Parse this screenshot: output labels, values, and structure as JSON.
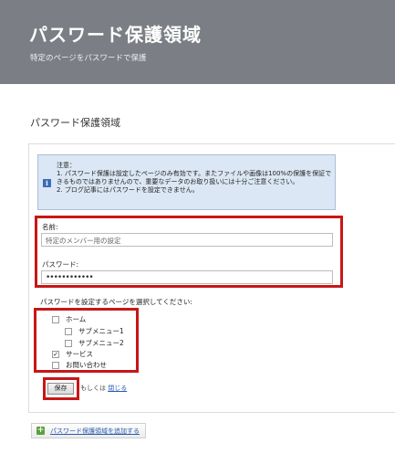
{
  "header": {
    "title": "パスワード保護領域",
    "subtitle": "特定のページをパスワードで保護"
  },
  "section_title": "パスワード保護領域",
  "notice": {
    "icon": "info-icon",
    "heading": "注意：",
    "line1": "1. パスワード保護は設定したページのみ有効です。またファイルや画像は100%の保護を保証できるものではありませんので、重要なデータのお取り扱いには十分ご注意ください。",
    "line2": "2. ブログ記事にはパスワードを設定できません。"
  },
  "form": {
    "name_label": "名前:",
    "name_value": "特定のメンバー用の設定",
    "password_label": "パスワード:",
    "password_value": "••••••••••••",
    "pages_label": "パスワードを設定するページを選択してください:",
    "pages": [
      {
        "label": "ホーム",
        "checked": false
      },
      {
        "label": "サブメニュー1",
        "checked": false
      },
      {
        "label": "サブメニュー2",
        "checked": false
      },
      {
        "label": "サービス",
        "checked": true
      },
      {
        "label": "お問い合わせ",
        "checked": false
      }
    ]
  },
  "actions": {
    "save_label": "保存",
    "or_text": "もしくは",
    "close_label": "閉じる",
    "add_label": "パスワード保護領域を追加する"
  },
  "colors": {
    "header_bg": "#7b7e84",
    "highlight": "#c81616",
    "notice_bg": "#dbe7f4",
    "link": "#2a5db0"
  }
}
